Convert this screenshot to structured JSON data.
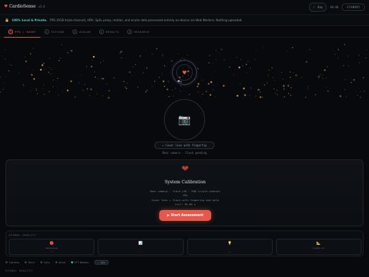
{
  "header": {
    "brand_name": "CardioSense",
    "version": "v3.4",
    "theme_label": "Day",
    "time": "00:00",
    "mode_label": "STANDBY"
  },
  "privacy": {
    "strong": "100% Local & Private.",
    "text": "PPG (RGB triple-channel), HRV, SpO₂ proxy, motion, and ocular data processed entirely on-device via Web Workers. Nothing uploaded."
  },
  "tabs": [
    {
      "num": "1",
      "label": "PPG / HEART"
    },
    {
      "num": "2",
      "label": "FATIGUE"
    },
    {
      "num": "3",
      "label": "OCULAR"
    },
    {
      "num": "4",
      "label": "RESULTS"
    },
    {
      "num": "5",
      "label": "RESEARCH"
    }
  ],
  "camera": {
    "cover_text": "▸ Cover lens with fingertip",
    "status_line": "Rear camera · Flash pending"
  },
  "calibration": {
    "title": "System Calibration",
    "line1": "Rear camera · flash LED · RGB triple-channel",
    "line2": "PPG",
    "line3": "Cover lens + flash with fingertip and hold",
    "line4": "still 30-60 s",
    "start_label": "▶ Start Assessment"
  },
  "signal_quality": {
    "label": "SIGNAL QUALITY",
    "cells": [
      {
        "icon": "🔴",
        "name": "PERFUSION",
        "value": "--",
        "color": "#e8584a"
      },
      {
        "icon": "📊",
        "name": "",
        "value": "--",
        "color": "#8fa0b3"
      },
      {
        "icon": "💡",
        "name": "",
        "value": "--",
        "color": "#f2c94c"
      },
      {
        "icon": "📐",
        "name": "STABILITY",
        "value": "--",
        "color": "#d8a43a"
      }
    ]
  },
  "sensors": {
    "items": [
      {
        "label": "Camera",
        "ok": false
      },
      {
        "label": "Torch",
        "ok": false
      },
      {
        "label": "Gyro",
        "ok": false
      },
      {
        "label": "Accel",
        "ok": false
      },
      {
        "label": "FFT Worker",
        "ok": true
      }
    ],
    "badge": "— Ips"
  },
  "bottom_label": "SIGNAL QUALITY"
}
